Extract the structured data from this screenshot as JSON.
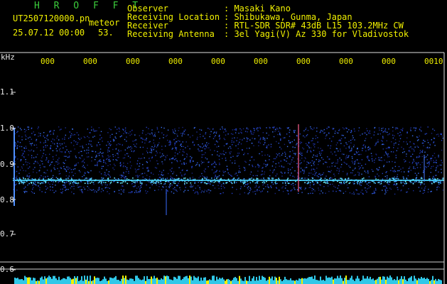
{
  "header": {
    "program": "H R O F F T",
    "filename": "UT2507120000.pn",
    "mode": "meteor",
    "datetime": "25.07.12 00:00",
    "count": "53.",
    "observer_label": "Observer",
    "observer_value": ": Masaki Kano",
    "location_label": "Receiving Location",
    "location_value": ": Shibukawa, Gunma, Japan",
    "receiver_label": "Receiver",
    "receiver_value": ": RTL-SDR SDR# 43dB L15 103.2MHz CW",
    "antenna_label": "Receiving Antenna",
    "antenna_value": ": 3el Yagi(V) Az 330 for Vladivostok"
  },
  "axis": {
    "unit": "kHz",
    "y_ticks": [
      "1.1",
      "1.0",
      "0.9",
      "0.8",
      "0.7",
      "0.6"
    ],
    "x_ticks": [
      "000",
      "000",
      "000",
      "000",
      "000",
      "000",
      "000",
      "000",
      "000",
      "0010"
    ]
  },
  "colors": {
    "background": "#000000",
    "title_green": "#3ccd3c",
    "info_yellow": "#f0f000",
    "noise_blue": "#1a3cc8",
    "trace_cyan": "#40e0ff"
  }
}
